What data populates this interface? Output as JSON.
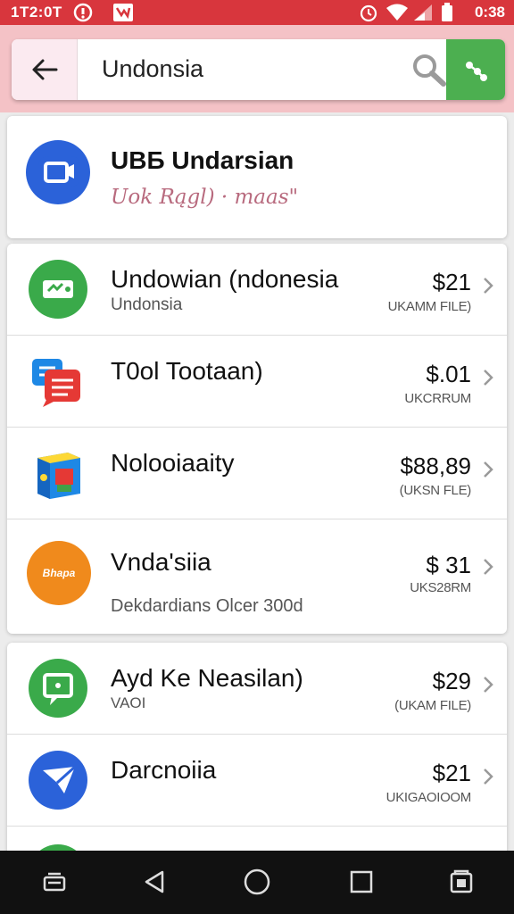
{
  "status_bar": {
    "time_left": "1T2:0T",
    "time_right": "0:38",
    "icons": [
      "circle-alert-icon",
      "app-notification-icon",
      "alarm-icon",
      "wifi-icon",
      "signal-icon",
      "battery-icon"
    ]
  },
  "search": {
    "query": "Undonsia",
    "back_icon": "arrow-back-icon",
    "search_icon": "search-icon",
    "share_icon": "share-icon"
  },
  "featured": {
    "title": "UBБ Undarsian",
    "subtitle": "Uok  Rągl) · maas\"",
    "icon": "video-chat-icon"
  },
  "list1": [
    {
      "title": "Undowian (ndonesia",
      "subtitle": "Undonsia",
      "price": "$21",
      "meta": "UKAMM FILE)",
      "icon": "ticket-icon",
      "color": "#3aaa4a"
    },
    {
      "title": "T0ol Tootaan)",
      "subtitle": "",
      "price": "$.01",
      "meta": "UKCRRUM",
      "icon": "chat-bubbles-icon",
      "color": "#e53935"
    },
    {
      "title": "Nolooiaaity",
      "subtitle": "",
      "price": "$88,89",
      "meta": "(UKSN  FLE)",
      "icon": "software-box-icon",
      "color": "#1e88e5"
    },
    {
      "title": "Vnda'siia",
      "subtitle": "Dekdardians Olcer 300d",
      "price": "$ 31",
      "meta": "UKS28RM",
      "icon": "orange-badge-icon",
      "color": "#f08a1c",
      "badge_text": "Bhapa"
    }
  ],
  "list2": [
    {
      "title": "Ayd Ke Neasilan)",
      "subtitle": "VAOI",
      "price": "$29",
      "meta": "(UKAM FILE)",
      "icon": "green-chat-icon",
      "color": "#3aaa4a"
    },
    {
      "title": "Darcnoiia",
      "subtitle": "",
      "price": "$21",
      "meta": "UKIGAOIOOM",
      "icon": "send-icon",
      "color": "#2b62d9"
    }
  ],
  "nav": [
    "recents-icon",
    "back-triangle-icon",
    "home-circle-icon",
    "square-icon",
    "screenshot-icon"
  ],
  "colors": {
    "status": "#d8363d",
    "header": "#f4c2c6",
    "accent_green": "#4caf50"
  }
}
